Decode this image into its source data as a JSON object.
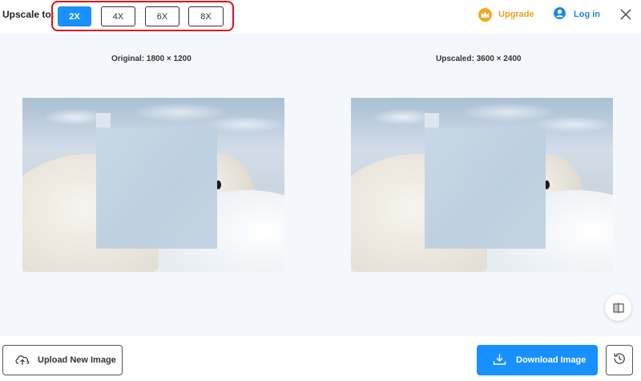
{
  "toolbar": {
    "upscale_label": "Upscale to:",
    "scales": [
      "2X",
      "4X",
      "6X",
      "8X"
    ],
    "selected_scale": "2X",
    "upgrade_label": "Upgrade",
    "login_label": "Log in"
  },
  "main": {
    "original_caption": "Original: 1800 × 1200",
    "upscaled_caption": "Upscaled: 3600 × 2400"
  },
  "bottom": {
    "upload_label": "Upload New Image",
    "download_label": "Download Image"
  },
  "icons": {
    "upgrade": "crown-icon",
    "login": "user-icon",
    "close": "close-icon",
    "compare": "compare-icon",
    "upload": "cloud-upload-icon",
    "download": "download-icon",
    "history": "history-icon"
  },
  "colors": {
    "accent": "#1890ff",
    "highlight_border": "#e0101b",
    "upgrade": "#f0a020",
    "login": "#1e88e5"
  }
}
